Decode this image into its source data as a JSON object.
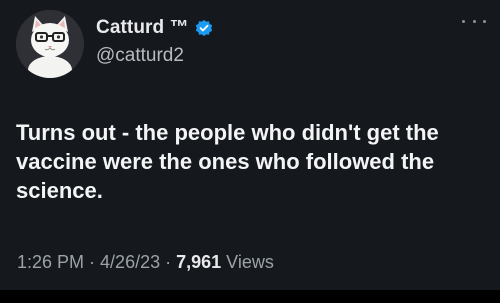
{
  "author": {
    "display_name": "Catturd ™",
    "handle": "@catturd2",
    "verified_color": "#1d9bf0",
    "avatar_icon": "white-cat-with-glasses-avatar"
  },
  "tweet": {
    "text": "Turns out - the people who didn't get the vaccine were the ones who followed the science.",
    "time": "1:26 PM",
    "date": "4/26/23",
    "separator": "·",
    "views_count": "7,961",
    "views_label": "Views"
  },
  "menu": {
    "more_icon": "more-options-icon"
  },
  "colors": {
    "background": "#15181d",
    "text": "#e7e9ea",
    "muted": "#9ba2a8"
  }
}
